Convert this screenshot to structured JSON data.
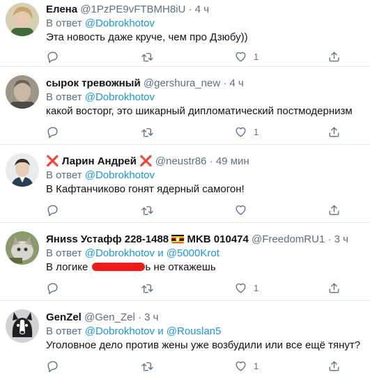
{
  "tweets": [
    {
      "name": "Елена",
      "handle": "@1PzPE9vFTBMH8iU",
      "dot": "·",
      "time": "4 ч",
      "replying_prefix": "В ответ",
      "mentions": [
        "@Dobrokhotov"
      ],
      "text": "Эта новость даже круче, чем про Дзюбу))",
      "like_count": "1"
    },
    {
      "name": "сырок тревожный",
      "handle": "@gershura_new",
      "dot": "·",
      "time": "4 ч",
      "replying_prefix": "В ответ",
      "mentions": [
        "@Dobrokhotov"
      ],
      "text": "какой восторг, это шикарный дипломатический постмодернизм",
      "like_count": "1"
    },
    {
      "name_prefix": "❌",
      "name": "Ларин Андрей",
      "name_suffix": "❌",
      "handle": "@neustr86",
      "dot": "·",
      "time": "49 мин",
      "replying_prefix": "В ответ",
      "mentions": [
        "@Dobrokhotov"
      ],
      "text": "В Кафтанчиково гонят ядерный самогон!",
      "like_count": ""
    },
    {
      "name": "Яниss Устафф 228-1488",
      "name_after_flag": "MKB 010474",
      "handle": "@FreedomRU1",
      "dot": "·",
      "time": "3 ч",
      "replying_prefix": "В ответ",
      "mentions": [
        "@Dobrokhotov",
        "@5000Krot"
      ],
      "conj": "и",
      "text_before": "В логике",
      "text_tail": "ь",
      "text_after": "не откажешь",
      "like_count": "1"
    },
    {
      "name": "GenZel",
      "handle": "@Gen_Zel",
      "dot": "·",
      "time": "3 ч",
      "replying_prefix": "В ответ",
      "mentions": [
        "@Dobrokhotov",
        "@Rouslan5"
      ],
      "conj": "и",
      "text": "Уголовное дело против жены уже возбудили или все ещё тянут?",
      "like_count": "1"
    }
  ],
  "colors": {
    "accent": "#1b95e0",
    "muted": "#5b7083",
    "text": "#0f1419",
    "divider": "#e6ecf0",
    "redact": "#f01b1b"
  },
  "icons": [
    "reply-icon",
    "retweet-icon",
    "like-icon",
    "share-icon"
  ]
}
